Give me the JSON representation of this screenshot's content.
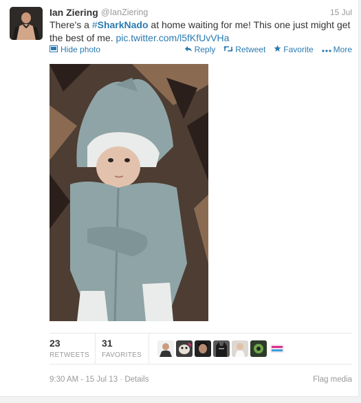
{
  "tweet": {
    "author": {
      "name": "Ian Ziering",
      "handle": "@IanZiering"
    },
    "date": "15 Jul",
    "text_parts": {
      "before": "There's a ",
      "hash_symbol": "#",
      "hashtag": "SharkNado",
      "after": " at home waiting for me! This one just might get the best of me. ",
      "link": "pic.twitter.com/l5fKfUvVHa"
    },
    "actions": {
      "hide_photo": "Hide photo",
      "reply": "Reply",
      "retweet": "Retweet",
      "favorite": "Favorite",
      "more": "More"
    },
    "stats": {
      "retweets_count": "23",
      "retweets_label": "RETWEETS",
      "favorites_count": "31",
      "favorites_label": "FAVORITES"
    },
    "footer": {
      "timestamp": "9:30 AM - 15 Jul 13",
      "separator": " · ",
      "details": "Details",
      "flag": "Flag media"
    }
  },
  "favoriters_icons": [
    "avatar-man-suit",
    "avatar-dog",
    "avatar-dark-hair",
    "avatar-batman",
    "avatar-woman-light",
    "avatar-green",
    "avatar-happy-sunday-logo"
  ],
  "colors": {
    "link": "#2a7ab0",
    "muted": "#999999",
    "text": "#333333"
  }
}
